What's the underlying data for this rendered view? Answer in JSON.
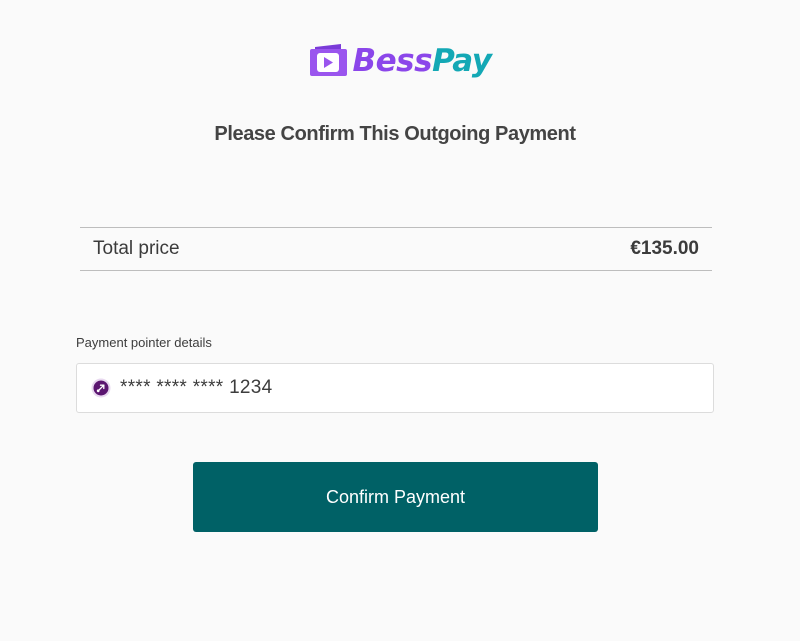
{
  "brand": {
    "name_part1": "Bess",
    "name_part2": "Pay",
    "logo_icon": "wallet-play-icon",
    "color_purple": "#8b46ea",
    "color_teal": "#13a8b5"
  },
  "page": {
    "title": "Please Confirm This Outgoing Payment"
  },
  "summary": {
    "total_label": "Total price",
    "total_value": "€135.00"
  },
  "pointer": {
    "label": "Payment pointer details",
    "icon": "payment-pointer-icon",
    "value": "**** **** **** 1234"
  },
  "actions": {
    "confirm_label": "Confirm Payment",
    "confirm_color": "#006166"
  }
}
